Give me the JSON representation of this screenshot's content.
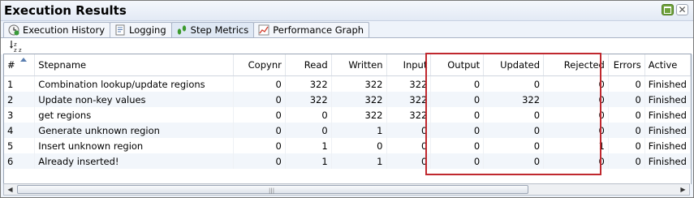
{
  "window": {
    "title": "Execution Results",
    "maximize_icon": "maximize-icon",
    "close_icon": "close-icon",
    "close_glyph": "✕"
  },
  "tabs": [
    {
      "label": "Execution History",
      "icon": "history-icon",
      "active": false
    },
    {
      "label": "Logging",
      "icon": "logging-icon",
      "active": false
    },
    {
      "label": "Step Metrics",
      "icon": "footsteps-icon",
      "active": true
    },
    {
      "label": "Performance Graph",
      "icon": "graph-icon",
      "active": false
    }
  ],
  "toolbar": {
    "sort_icon": "sort-az-icon"
  },
  "table": {
    "columns": [
      "#",
      "Stepname",
      "Copynr",
      "Read",
      "Written",
      "Input",
      "Output",
      "Updated",
      "Rejected",
      "Errors",
      "Active"
    ],
    "rows": [
      [
        "1",
        "Combination lookup/update regions",
        "0",
        "322",
        "322",
        "322",
        "0",
        "0",
        "0",
        "0",
        "Finished"
      ],
      [
        "2",
        "Update non-key values",
        "0",
        "322",
        "322",
        "322",
        "0",
        "322",
        "0",
        "0",
        "Finished"
      ],
      [
        "3",
        "get regions",
        "0",
        "0",
        "322",
        "322",
        "0",
        "0",
        "0",
        "0",
        "Finished"
      ],
      [
        "4",
        "Generate unknown region",
        "0",
        "0",
        "1",
        "0",
        "0",
        "0",
        "0",
        "0",
        "Finished"
      ],
      [
        "5",
        "Insert unknown region",
        "0",
        "1",
        "0",
        "0",
        "0",
        "0",
        "1",
        "0",
        "Finished"
      ],
      [
        "6",
        "Already inserted!",
        "0",
        "1",
        "1",
        "0",
        "0",
        "0",
        "0",
        "0",
        "Finished"
      ]
    ]
  },
  "scrollbar": {
    "left_arrow": "◀",
    "right_arrow": "▶",
    "grip": "|||"
  },
  "colors": {
    "highlight": "#c0282e",
    "row_alt": "#f2f6fb",
    "accent": "#5b7fb0"
  }
}
